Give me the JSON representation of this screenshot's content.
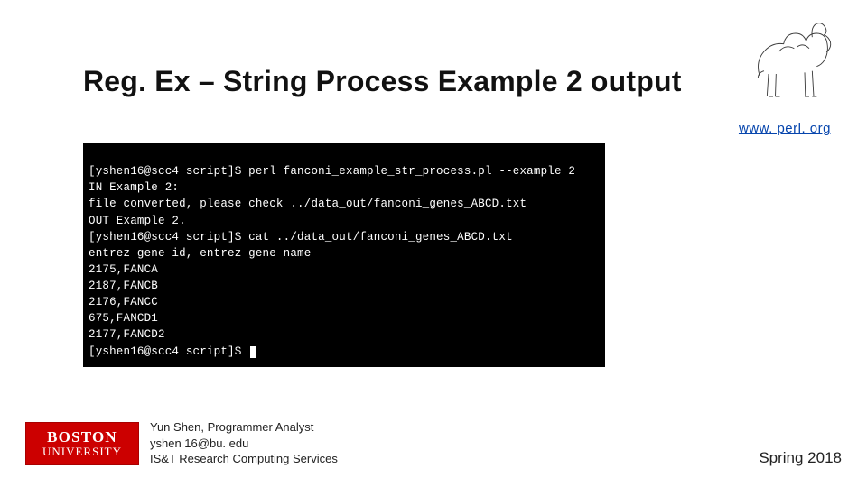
{
  "title": "Reg. Ex – String Process Example 2 output",
  "link": {
    "label": "www. perl. org"
  },
  "terminal": {
    "lines": [
      "[yshen16@scc4 script]$ perl fanconi_example_str_process.pl --example 2",
      "IN Example 2:",
      "file converted, please check ../data_out/fanconi_genes_ABCD.txt",
      "OUT Example 2.",
      "[yshen16@scc4 script]$ cat ../data_out/fanconi_genes_ABCD.txt",
      "entrez gene id, entrez gene name",
      "2175,FANCA",
      "2187,FANCB",
      "2176,FANCC",
      "675,FANCD1",
      "2177,FANCD2",
      "[yshen16@scc4 script]$ "
    ]
  },
  "footer": {
    "logo": {
      "line1": "BOSTON",
      "line2": "UNIVERSITY"
    },
    "author": {
      "name": "Yun Shen, Programmer Analyst",
      "email": "yshen 16@bu. edu",
      "dept": "IS&T Research Computing Services"
    },
    "semester": "Spring 2018"
  },
  "icons": {
    "camel": "camel-illustration"
  }
}
